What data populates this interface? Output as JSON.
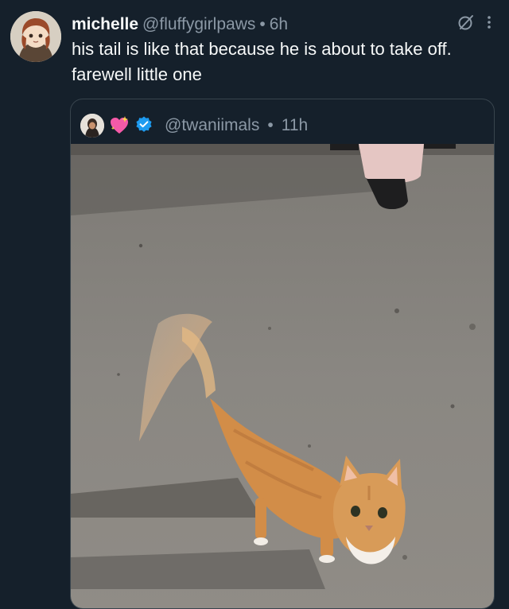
{
  "tweet": {
    "display_name": "michelle",
    "handle": "@fluffygirlpaws",
    "separator": "•",
    "time": "6h",
    "text": "his tail is like that because he is about to take off. farewell little one"
  },
  "quote": {
    "handle": "@twaniimals",
    "separator": "•",
    "time": "11h",
    "icons": [
      "avatar",
      "sparkling-heart-icon",
      "verified-badge-icon"
    ]
  },
  "header_icons": [
    "grok-icon",
    "more-options-icon"
  ],
  "photo": {
    "subject": "orange-tabby-cat",
    "colors": {
      "floor": "#8a8782",
      "cat": "#d28d48",
      "shadow": "#3f3d3a"
    }
  },
  "colors": {
    "background": "#15202b",
    "text": "#f7f9f9",
    "secondary": "#8b98a5",
    "border": "#38444d",
    "verified": "#1d9bf0"
  }
}
